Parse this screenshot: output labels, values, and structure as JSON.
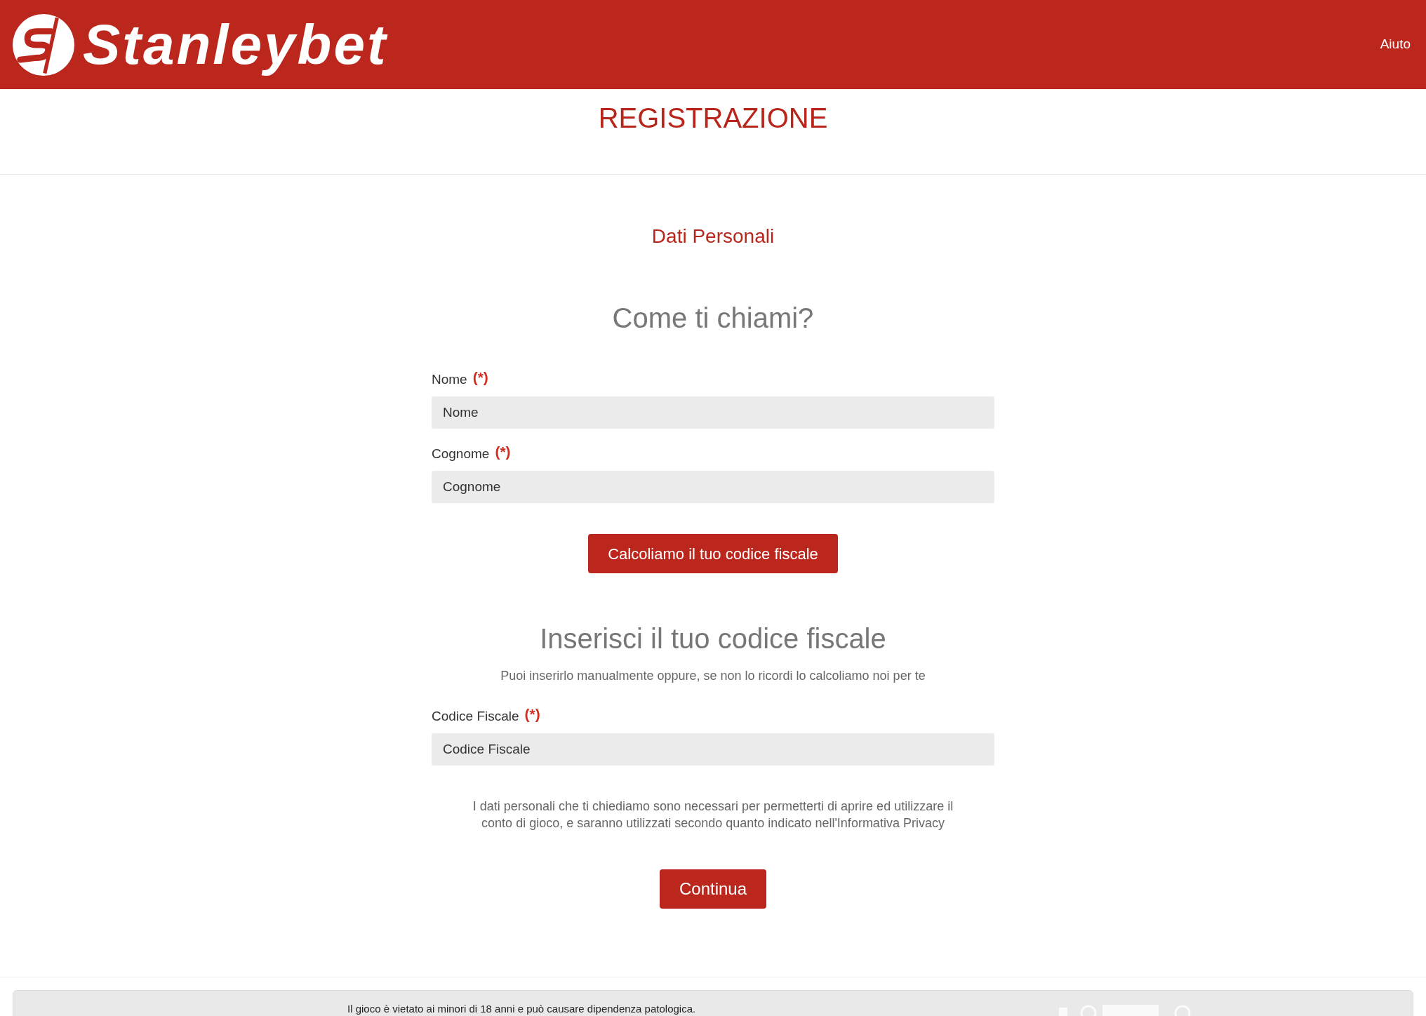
{
  "header": {
    "logo_text": "Stanleybet",
    "help_link": "Aiuto"
  },
  "page_title": "REGISTRAZIONE",
  "step_title": "Dati Personali",
  "sections": [
    {
      "heading": "Come ti chiami?",
      "fields": [
        {
          "label": "Nome",
          "required_mark": "(*)",
          "placeholder": "Nome"
        },
        {
          "label": "Cognome",
          "required_mark": "(*)",
          "placeholder": "Cognome"
        }
      ],
      "button": "Calcoliamo il tuo codice fiscale"
    },
    {
      "heading": "Inserisci il tuo codice fiscale",
      "subtitle": "Puoi inserirlo manualmente oppure, se non lo ricordi lo calcoliamo noi per te",
      "fields": [
        {
          "label": "Codice Fiscale",
          "required_mark": "(*)",
          "placeholder": "Codice Fiscale"
        }
      ]
    }
  ],
  "privacy_note": "I dati personali che ti chiediamo sono necessari per permetterti di aprire ed utilizzare il conto di gioco, e saranno utilizzati secondo quanto indicato nell'Informativa Privacy",
  "continue_button": "Continua",
  "footer": {
    "notice": "Il gioco è vietato ai minori di 18 anni e può causare dipendenza patologica."
  }
}
